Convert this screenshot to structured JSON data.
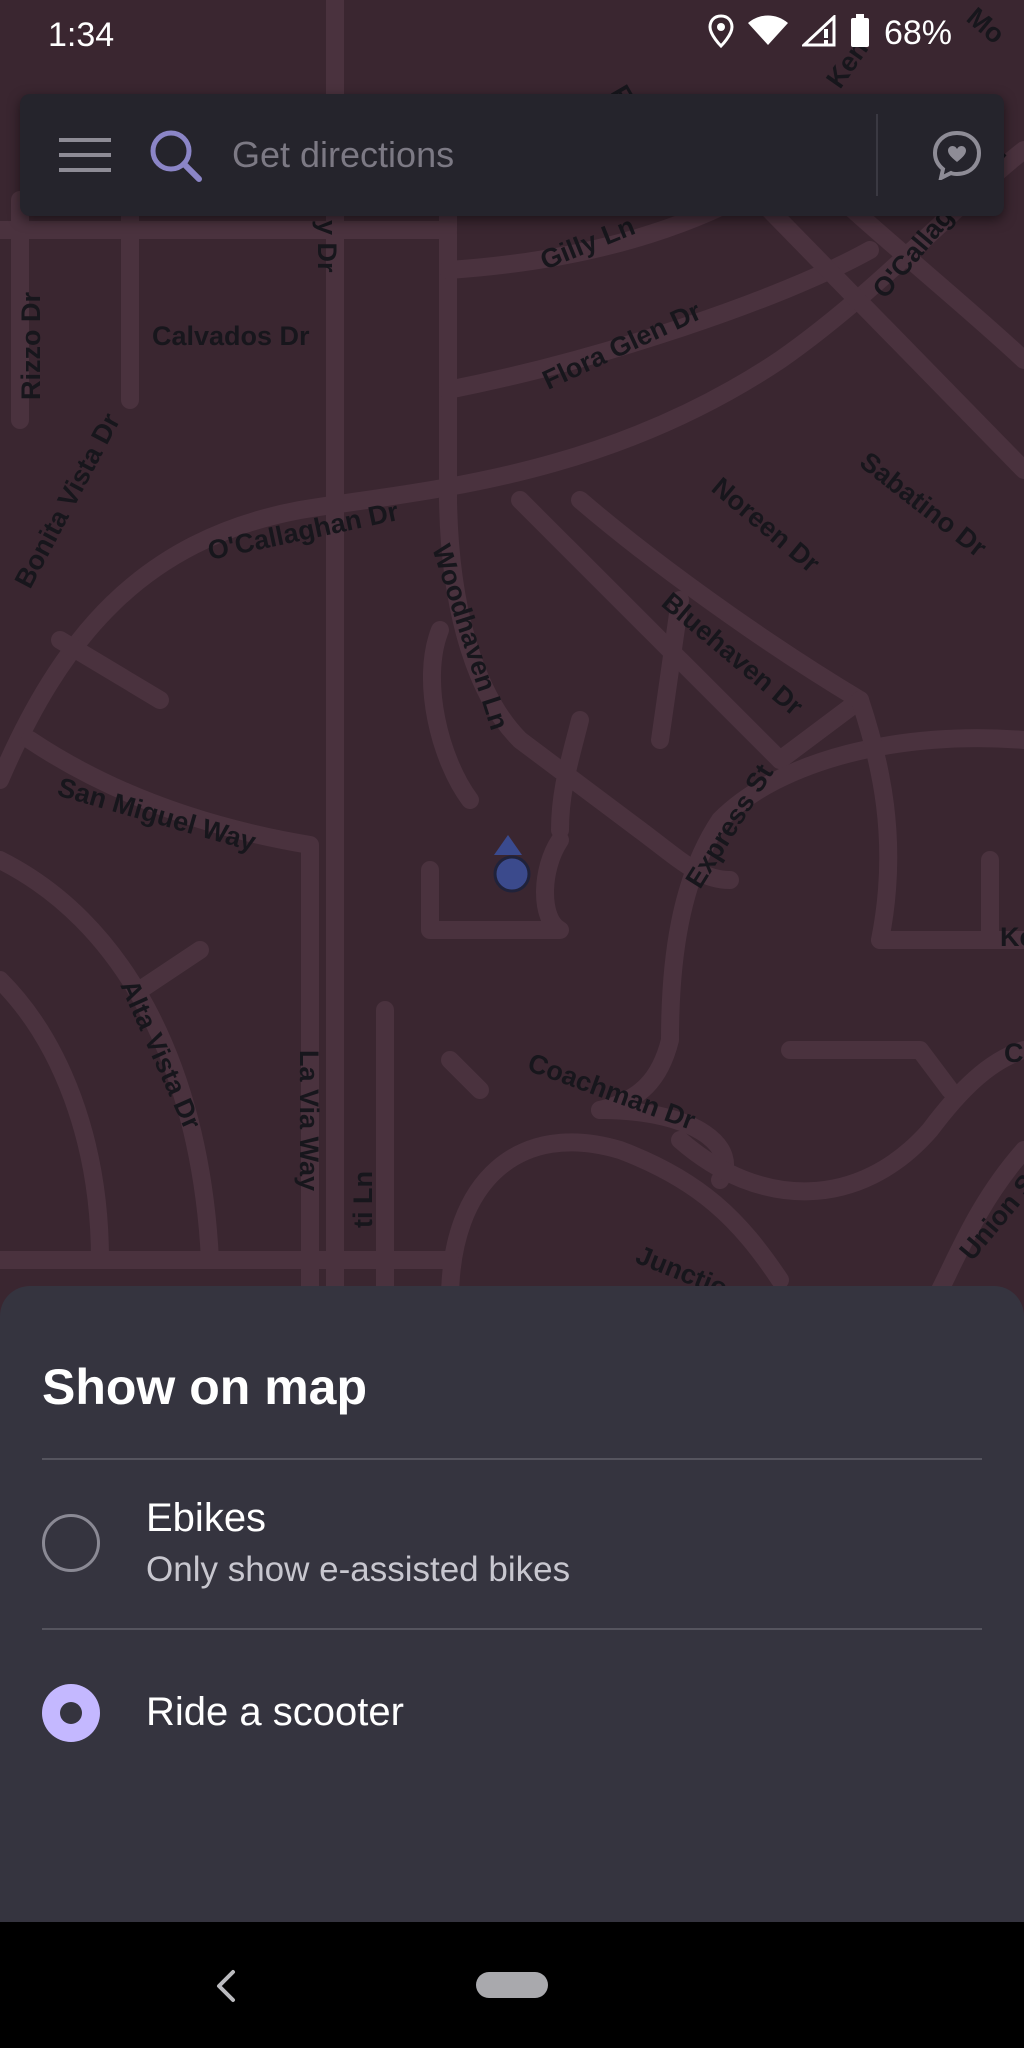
{
  "status_bar": {
    "time": "1:34",
    "battery_percent": "68%",
    "icons": [
      "location-icon",
      "wifi-icon",
      "cell-signal-icon",
      "battery-icon"
    ]
  },
  "search": {
    "placeholder": "Get directions",
    "menu_icon": "hamburger-menu-icon",
    "search_icon": "search-icon",
    "chat_icon": "chat-heart-icon"
  },
  "map": {
    "streets": [
      "Rizzo Dr",
      "Calvados Dr",
      "y Dr",
      "Gilly Ln",
      "Flora Glen Dr",
      "O'Callaghan Dr",
      "O'Callaghan Dr",
      "Sabatino Dr",
      "Noreen Dr",
      "Bonita Vista Dr",
      "Woodhaven Ln",
      "Bluehaven Dr",
      "San Miguel Way",
      "Express St",
      "Alta Vista Dr",
      "La Via Way",
      "Coachman Dr",
      "Junctio",
      "Union S",
      "Ke",
      "C",
      "Fi",
      "Ken",
      "Mo",
      "ti Ln"
    ],
    "colors": {
      "background": "#3a2630",
      "road": "#4d3441",
      "location_dot": "#3b4a8c"
    }
  },
  "sheet": {
    "title": "Show on map",
    "options": [
      {
        "label": "Ebikes",
        "sublabel": "Only show e-assisted bikes",
        "selected": false
      },
      {
        "label": "Ride a scooter",
        "selected": true
      }
    ],
    "accent_color": "#c4b8ff"
  },
  "nav_bar": {
    "back_icon": "back-chevron-icon",
    "home_icon": "home-pill-icon"
  }
}
